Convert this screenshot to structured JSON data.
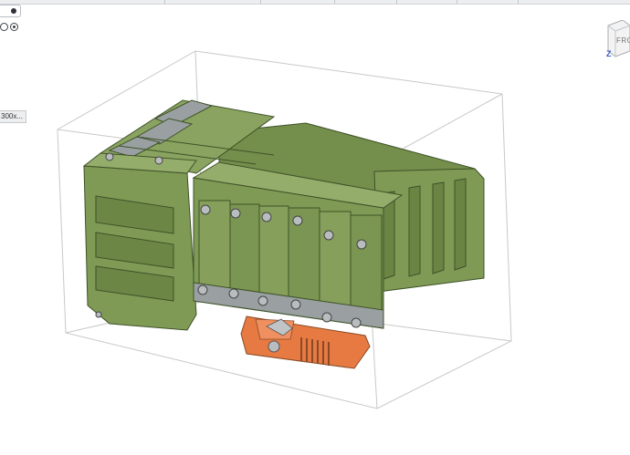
{
  "viewcube": {
    "face_label": "FRON",
    "axis_label": "Z"
  },
  "selection": {
    "dimension_label": "300x..."
  },
  "colors": {
    "model_green": "#7f9a55",
    "model_green_dark": "#55703a",
    "base_orange": "#e67a42",
    "bounding_box": "#c8c8c8",
    "viewcube_axis": "#3b56c9"
  },
  "icons": [
    "filter-icon",
    "radio-icon",
    "viewcube-icon",
    "screw-icon"
  ]
}
